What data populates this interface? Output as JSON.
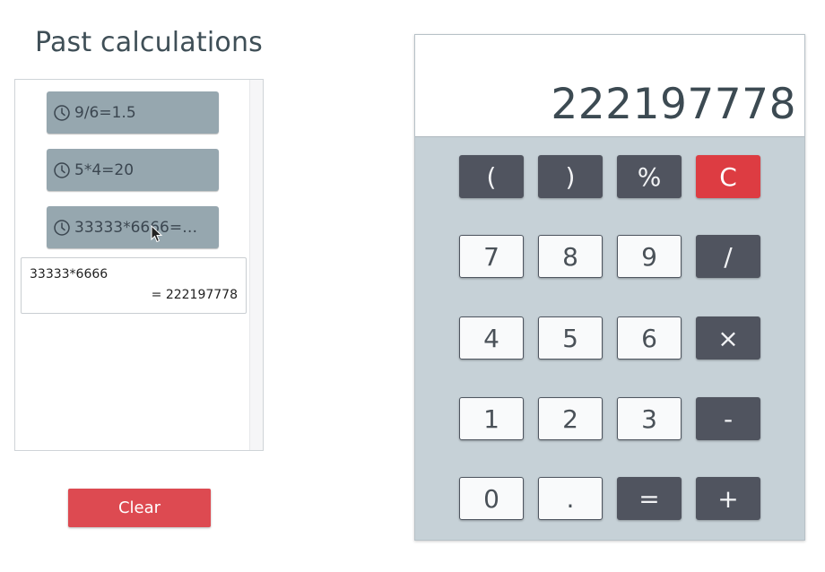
{
  "history": {
    "title": "Past calculations",
    "items": [
      {
        "label": "9/6=1.5"
      },
      {
        "label": "5*4=20"
      },
      {
        "label": "33333*6666=…"
      }
    ],
    "detail": {
      "expression": "33333*6666",
      "result": "= 222197778"
    },
    "clear_label": "Clear"
  },
  "calculator": {
    "display": "222197778",
    "keys": {
      "open_paren": "(",
      "close_paren": ")",
      "percent": "%",
      "clear": "C",
      "seven": "7",
      "eight": "8",
      "nine": "9",
      "divide": "/",
      "four": "4",
      "five": "5",
      "six": "6",
      "multiply": "×",
      "one": "1",
      "two": "2",
      "three": "3",
      "minus": "-",
      "zero": "0",
      "decimal": ".",
      "equals": "=",
      "plus": "+"
    }
  },
  "colors": {
    "history_item_bg": "#96a7af",
    "clear_red": "#dd4a51",
    "operator_key_bg": "#50545f",
    "calculator_body_bg": "#c6d1d7"
  }
}
